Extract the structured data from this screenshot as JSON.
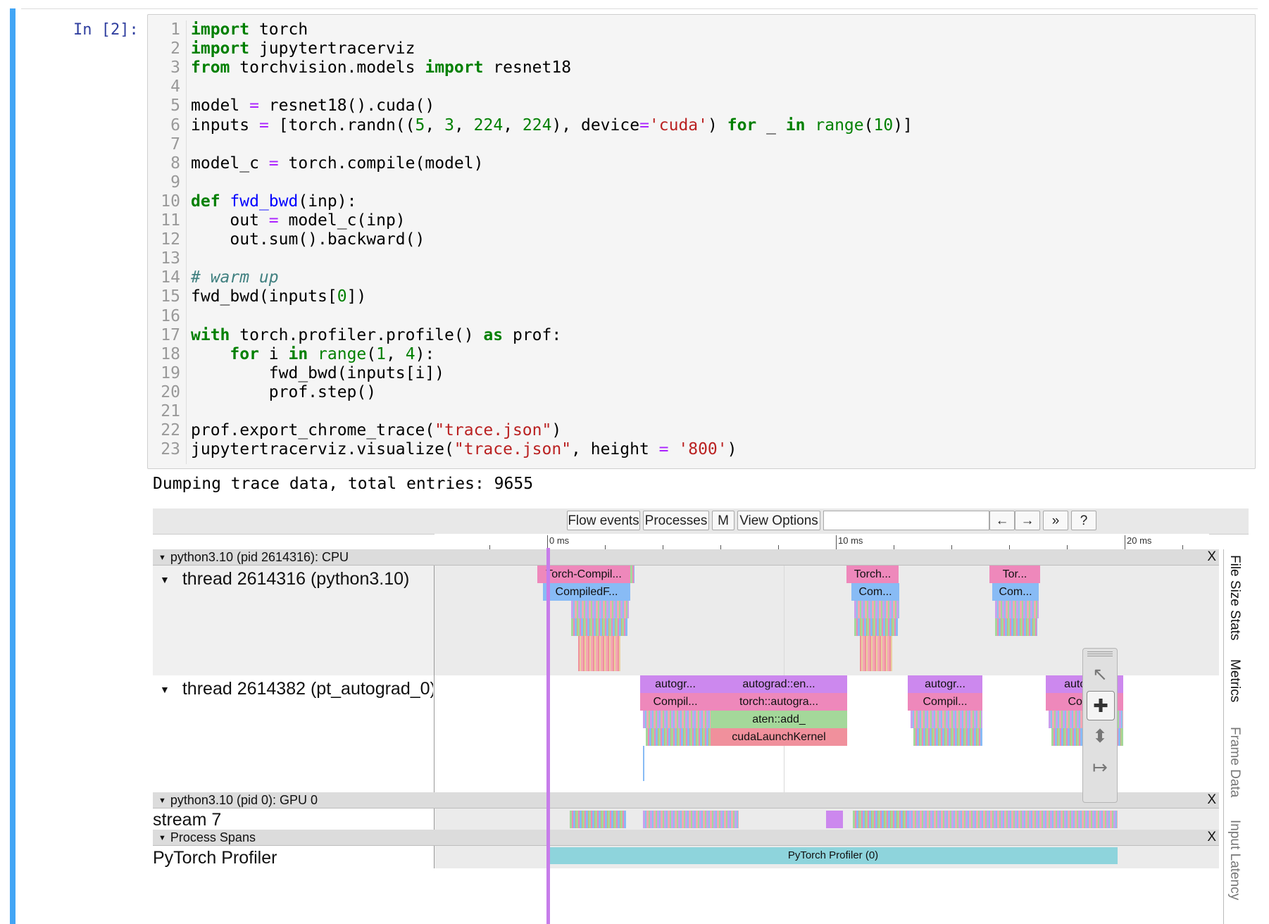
{
  "notebook": {
    "prompt": "In [2]:",
    "code_lines": [
      [
        {
          "t": "import",
          "c": "kw"
        },
        {
          "t": " torch"
        }
      ],
      [
        {
          "t": "import",
          "c": "kw"
        },
        {
          "t": " jupytertracerviz"
        }
      ],
      [
        {
          "t": "from",
          "c": "kw"
        },
        {
          "t": " torchvision.models "
        },
        {
          "t": "import",
          "c": "kw"
        },
        {
          "t": " resnet18"
        }
      ],
      [],
      [
        {
          "t": "model "
        },
        {
          "t": "=",
          "c": "op"
        },
        {
          "t": " resnet18().cuda()"
        }
      ],
      [
        {
          "t": "inputs "
        },
        {
          "t": "=",
          "c": "op"
        },
        {
          "t": " [torch.randn(("
        },
        {
          "t": "5",
          "c": "num"
        },
        {
          "t": ", "
        },
        {
          "t": "3",
          "c": "num"
        },
        {
          "t": ", "
        },
        {
          "t": "224",
          "c": "num"
        },
        {
          "t": ", "
        },
        {
          "t": "224",
          "c": "num"
        },
        {
          "t": "), device"
        },
        {
          "t": "=",
          "c": "op"
        },
        {
          "t": "'cuda'",
          "c": "str"
        },
        {
          "t": ") "
        },
        {
          "t": "for",
          "c": "kw"
        },
        {
          "t": " _ "
        },
        {
          "t": "in",
          "c": "kw"
        },
        {
          "t": " "
        },
        {
          "t": "range",
          "c": "bi"
        },
        {
          "t": "("
        },
        {
          "t": "10",
          "c": "num"
        },
        {
          "t": ")]"
        }
      ],
      [],
      [
        {
          "t": "model_c "
        },
        {
          "t": "=",
          "c": "op"
        },
        {
          "t": " torch.compile(model)"
        }
      ],
      [],
      [
        {
          "t": "def",
          "c": "kw"
        },
        {
          "t": " "
        },
        {
          "t": "fwd_bwd",
          "c": "fn"
        },
        {
          "t": "(inp):"
        }
      ],
      [
        {
          "t": "    out "
        },
        {
          "t": "=",
          "c": "op"
        },
        {
          "t": " model_c(inp)"
        }
      ],
      [
        {
          "t": "    out.sum().backward()"
        }
      ],
      [],
      [
        {
          "t": "# warm up",
          "c": "cm"
        }
      ],
      [
        {
          "t": "fwd_bwd(inputs["
        },
        {
          "t": "0",
          "c": "num"
        },
        {
          "t": "])"
        }
      ],
      [],
      [
        {
          "t": "with",
          "c": "kw"
        },
        {
          "t": " torch.profiler.profile() "
        },
        {
          "t": "as",
          "c": "kw"
        },
        {
          "t": " prof:"
        }
      ],
      [
        {
          "t": "    "
        },
        {
          "t": "for",
          "c": "kw"
        },
        {
          "t": " i "
        },
        {
          "t": "in",
          "c": "kw"
        },
        {
          "t": " "
        },
        {
          "t": "range",
          "c": "bi"
        },
        {
          "t": "("
        },
        {
          "t": "1",
          "c": "num"
        },
        {
          "t": ", "
        },
        {
          "t": "4",
          "c": "num"
        },
        {
          "t": "):"
        }
      ],
      [
        {
          "t": "        fwd_bwd(inputs[i])"
        }
      ],
      [
        {
          "t": "        prof.step()"
        }
      ],
      [],
      [
        {
          "t": "prof.export_chrome_trace("
        },
        {
          "t": "\"trace.json\"",
          "c": "str"
        },
        {
          "t": ")"
        }
      ],
      [
        {
          "t": "jupytertracerviz.visualize("
        },
        {
          "t": "\"trace.json\"",
          "c": "str"
        },
        {
          "t": ", height "
        },
        {
          "t": "=",
          "c": "op"
        },
        {
          "t": " "
        },
        {
          "t": "'800'",
          "c": "str"
        },
        {
          "t": ")"
        }
      ]
    ],
    "output": "Dumping trace data, total entries: 9655"
  },
  "viewer": {
    "toolbar": {
      "flow_events": "Flow events",
      "processes": "Processes",
      "m": "M",
      "view_options": "View Options",
      "left_arrow": "←",
      "right_arrow": "→",
      "more": "»",
      "help": "?"
    },
    "ruler": {
      "labels": [
        "0 ms",
        "10 ms",
        "20 ms"
      ]
    },
    "processes": {
      "cpu": {
        "label": "python3.10 (pid 2614316): CPU",
        "close": "X"
      },
      "gpu": {
        "label": "python3.10 (pid 0): GPU 0",
        "close": "X"
      },
      "spans": {
        "label": "Process Spans",
        "close": "X"
      }
    },
    "threads": {
      "main": "thread 2614316 (python3.10)",
      "autograd": "thread 2614382 (pt_autograd_0)",
      "stream": "stream 7",
      "profiler": "PyTorch Profiler"
    },
    "slices": {
      "torch_compile_1": "Torch-Compil...",
      "compiled_1": "CompiledF...",
      "torch_compile_2": "Torch...",
      "compiled_2": "Com...",
      "torch_compile_3": "Tor...",
      "compiled_3": "Com...",
      "autograd_1": "autogr...",
      "compil_1": "Compil...",
      "autograd_engine": "autograd::en...",
      "torch_autograd": "torch::autogra...",
      "aten_add": "aten::add_",
      "cuda_launch": "cudaLaunchKernel",
      "autograd_2": "autogr...",
      "compil_2": "Compil...",
      "autograd_3": "autogr...",
      "com_3": "Com...",
      "profiler_span": "PyTorch Profiler (0)"
    },
    "side_tabs": [
      "File Size Stats",
      "Metrics",
      "Frame Data",
      "Input Latency"
    ],
    "colors": {
      "cell_accent": "#42a5f5",
      "time_cursor": "#c77dea",
      "profiler_span": "#8ed4dc"
    }
  }
}
